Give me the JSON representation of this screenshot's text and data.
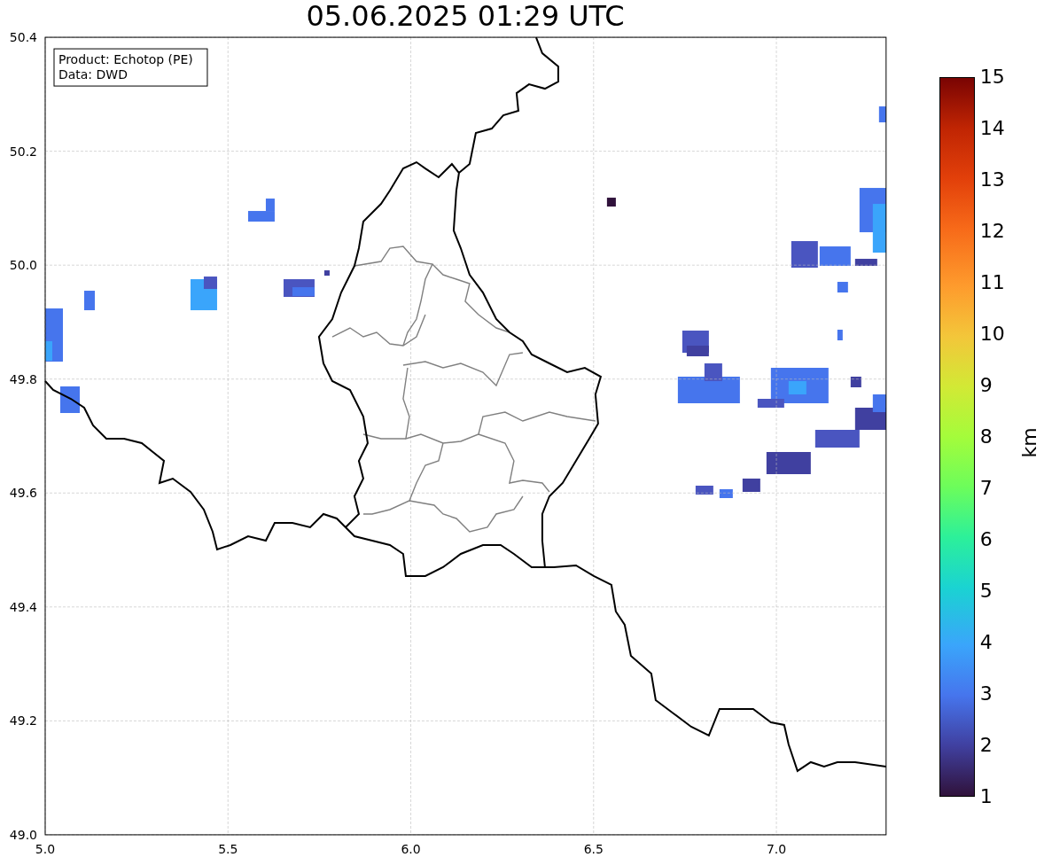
{
  "title": "05.06.2025 01:29 UTC",
  "legend": [
    "Product: Echotop (PE)",
    "Data: DWD"
  ],
  "axes": {
    "x_ticks": [
      "5.0",
      "5.5",
      "6.0",
      "6.5",
      "7.0"
    ],
    "y_ticks": [
      "50.4",
      "50.2",
      "50.0",
      "49.8",
      "49.6",
      "49.4",
      "49.2",
      "49.0"
    ]
  },
  "colorbar": {
    "label": "km",
    "ticks": [
      "15",
      "14",
      "13",
      "12",
      "11",
      "10",
      "9",
      "8",
      "7",
      "6",
      "5",
      "4",
      "3",
      "2",
      "1"
    ]
  }
}
